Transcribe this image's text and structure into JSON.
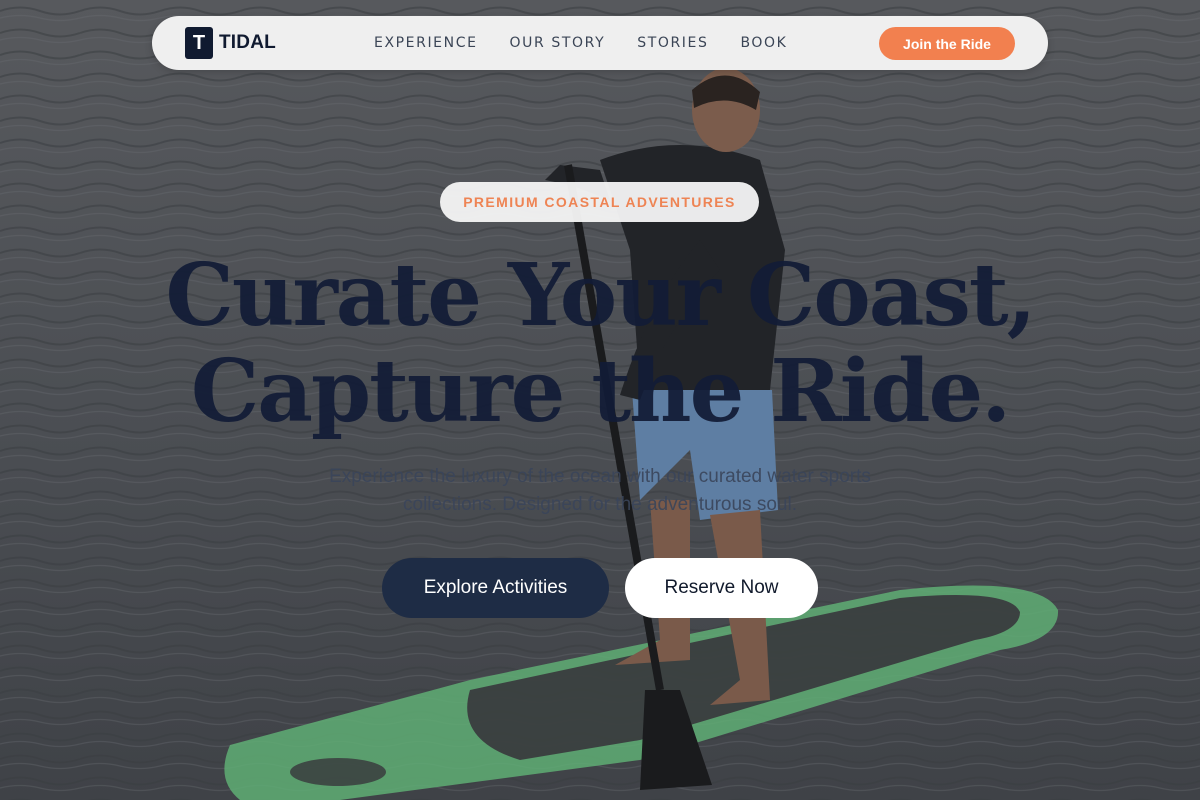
{
  "colors": {
    "accent": "#f2804f",
    "navy": "#121c36",
    "button_dark": "#1e2c45",
    "nav_bg": "#efefef"
  },
  "nav": {
    "logo_mark": "T",
    "logo_text": "TIDAL",
    "links": [
      "EXPERIENCE",
      "OUR STORY",
      "STORIES",
      "BOOK"
    ],
    "cta_label": "Join the Ride"
  },
  "hero": {
    "eyebrow": "PREMIUM COASTAL ADVENTURES",
    "headline_line1": "Curate Your Coast,",
    "headline_line2": "Capture the Ride.",
    "subtitle": "Experience the luxury of the ocean with our curated water sports collections. Designed for the adventurous soul.",
    "primary_button": "Explore Activities",
    "secondary_button": "Reserve Now",
    "background_image": "paddleboarder-on-ocean"
  }
}
